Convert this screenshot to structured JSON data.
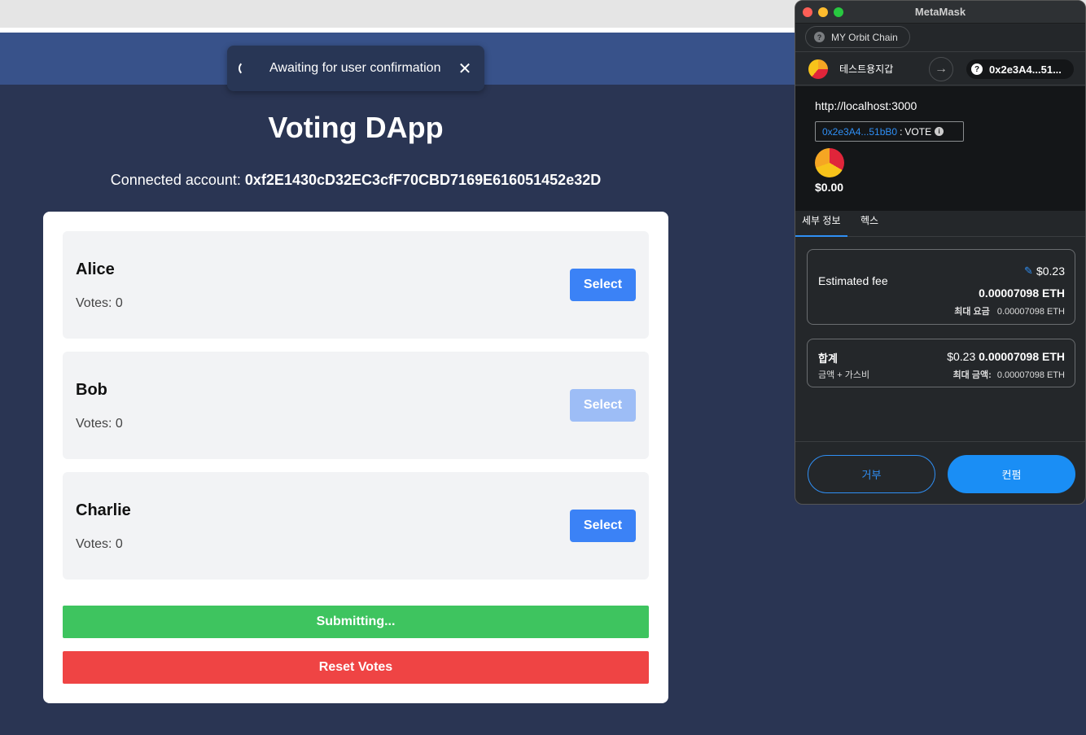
{
  "toast": {
    "text": "Awaiting for user confirmation",
    "close": "✕"
  },
  "app": {
    "title": "Voting DApp",
    "account_label": "Connected account:",
    "account_address": "0xf2E1430cD32EC3cfF70CBD7169E616051452e32D"
  },
  "candidates": [
    {
      "name": "Alice",
      "votes": "Votes: 0",
      "button": "Select",
      "state": "enabled"
    },
    {
      "name": "Bob",
      "votes": "Votes: 0",
      "button": "Select",
      "state": "disabled"
    },
    {
      "name": "Charlie",
      "votes": "Votes: 0",
      "button": "Select",
      "state": "enabled"
    }
  ],
  "actions": {
    "submit": "Submitting...",
    "reset": "Reset Votes"
  },
  "metamask": {
    "window_title": "MetaMask",
    "network": "MY Orbit Chain",
    "from_account": "테스트용지갑",
    "to_account": "0x2e3A4...51...",
    "origin": "http://localhost:3000",
    "method_address": "0x2e3A4...51bB0",
    "method_sep": ":",
    "method_name": "VOTE",
    "contract_value": "$0.00",
    "tabs": [
      "세부 정보",
      "헥스"
    ],
    "fee": {
      "label": "Estimated fee",
      "usd": "$0.23",
      "eth": "0.00007098 ETH",
      "max_label": "최대 요금",
      "max_value": "0.00007098 ETH"
    },
    "total": {
      "label": "합계",
      "sub": "금액 + 가스비",
      "usd": "$0.23",
      "eth": "0.00007098 ETH",
      "max_label": "최대 금액:",
      "max_value": "0.00007098 ETH"
    },
    "reject": "거부",
    "confirm": "컨펌"
  },
  "colors": {
    "page_bg": "#2a3553",
    "nav_band": "#38528a",
    "select_blue": "#3b82f6",
    "submit_green": "#3ec45f",
    "reset_red": "#ef4444",
    "mm_accent": "#2f8ff5"
  },
  "icons": [
    "spinner-icon",
    "close-icon",
    "question-icon",
    "arrow-right-icon",
    "info-icon",
    "edit-icon"
  ]
}
